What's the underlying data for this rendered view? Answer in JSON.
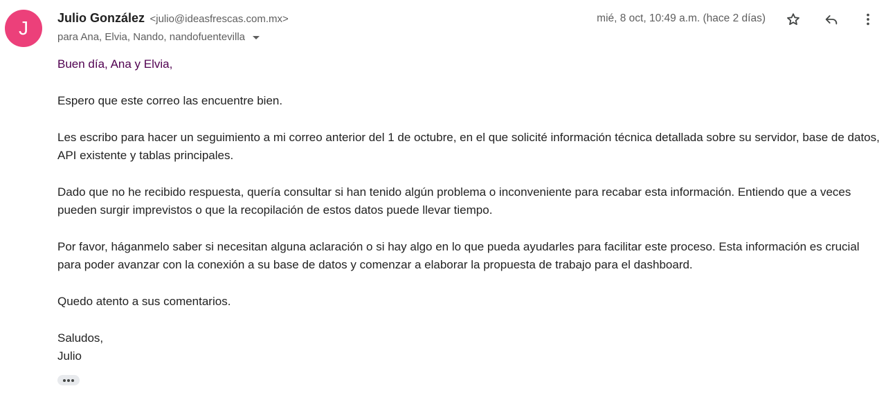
{
  "sender": {
    "avatar_initial": "J",
    "avatar_color": "#ec407a",
    "name": "Julio González",
    "email": "<julio@ideasfrescas.com.mx>"
  },
  "recipients": "para Ana, Elvia, Nando, nandofuentevilla",
  "date": "mié, 8 oct, 10:49 a.m. (hace 2 días)",
  "actions": {
    "star_icon": "star-outline-icon",
    "reply_icon": "reply-icon",
    "more_icon": "more-vertical-icon"
  },
  "body": {
    "greeting": "Buen día, Ana y Elvia,",
    "paragraphs": [
      "Espero que este correo las encuentre bien.",
      "Les escribo para hacer un seguimiento a mi correo anterior del 1 de octubre, en el que solicité información técnica detallada sobre su servidor, base de datos, API existente y tablas principales.",
      "Dado que no he recibido respuesta, quería consultar si han tenido algún problema o inconveniente para recabar esta información. Entiendo que a veces pueden surgir imprevistos o que la recopilación de estos datos puede llevar tiempo.",
      "Por favor, háganmelo saber si necesitan alguna aclaración o si hay algo en lo que pueda ayudarles para facilitar este proceso. Esta información es crucial para poder avanzar con la conexión a su base de datos y comenzar a elaborar la propuesta de trabajo para el dashboard.",
      "Quedo atento a sus comentarios."
    ],
    "closing": "Saludos,",
    "signature": "Julio"
  },
  "colors": {
    "greeting": "#500050",
    "muted_text": "#5e5e5e"
  }
}
